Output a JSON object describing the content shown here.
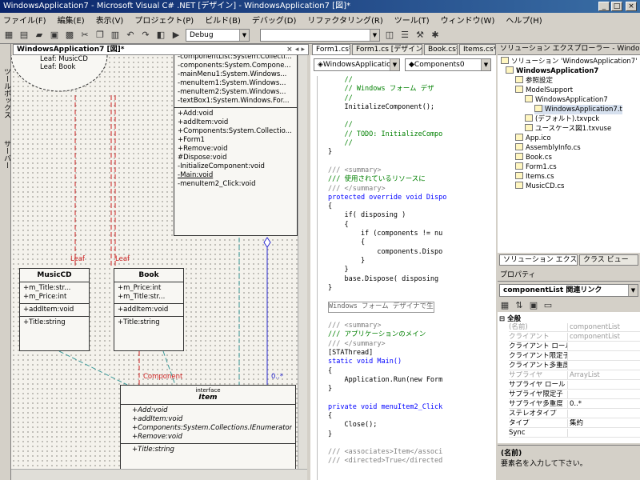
{
  "window": {
    "title": "WindowsApplication7 - Microsoft Visual C# .NET [デザイン] - WindowsApplication7 [図]*"
  },
  "menu": [
    "ファイル(F)",
    "編集(E)",
    "表示(V)",
    "プロジェクト(P)",
    "ビルド(B)",
    "デバッグ(D)",
    "リファクタリング(R)",
    "ツール(T)",
    "ウィンドウ(W)",
    "ヘルプ(H)"
  ],
  "toolbar": {
    "config": "Debug"
  },
  "left_tab": {
    "label1": "ツールボックス",
    "label2": "サーバー"
  },
  "tabs": {
    "designer": "WindowsApplication7 [図]*",
    "editor": [
      "Form1.cs*",
      "Form1.cs [デザイン]*",
      "Book.cs*",
      "Items.cs*"
    ]
  },
  "diagram": {
    "top_partial": [
      "Leaf: MusicCD",
      "Leaf: Book"
    ],
    "form1_fields": [
      "-componentList:System.Collecti...",
      "-components:System.Compone...",
      "-mainMenu1:System.Windows...",
      "-menuItem1:System.Windows...",
      "-menuItem2:System.Windows...",
      "-textBox1:System.Windows.For..."
    ],
    "form1_methods": [
      "+Add:void",
      "+addItem:void",
      "+Components:System.Collectio...",
      "+Form1",
      "+Remove:void",
      "#Dispose:void",
      "-InitializeComponent:void",
      "-Main:void",
      "-menuItem2_Click:void"
    ],
    "musiccd": {
      "name": "MusicCD",
      "fields": [
        "+m_Title:str...",
        "+m_Price:int"
      ],
      "methods": [
        "+addItem:void"
      ],
      "props": [
        "+Title:string"
      ]
    },
    "book": {
      "name": "Book",
      "fields": [
        "+m_Price:int",
        "+m_Title:str..."
      ],
      "methods": [
        "+addItem:void"
      ],
      "props": [
        "+Title:string"
      ]
    },
    "item": {
      "stereotype": "interface",
      "name": "Item",
      "methods": [
        "+Add:void",
        "+addItem:void",
        "+Components:System.Collections.IEnumerator",
        "+Remove:void"
      ],
      "props": [
        "+Title:string"
      ]
    },
    "labels": {
      "leaf1": "Leaf",
      "leaf2": "Leaf",
      "component": "Component",
      "mult": "0..*"
    }
  },
  "editor": {
    "class_combo": "WindowsApplicatior",
    "member_combo": "Components0"
  },
  "code_lines": [
    {
      "t": "    //",
      "c": "cm"
    },
    {
      "t": "    // Windows フォーム デザ",
      "c": "cm"
    },
    {
      "t": "    //",
      "c": "cm"
    },
    {
      "t": "    InitializeComponent();",
      "c": ""
    },
    {
      "t": "",
      "c": ""
    },
    {
      "t": "    //",
      "c": "cm"
    },
    {
      "t": "    // TODO: InitializeCompo",
      "c": "cm"
    },
    {
      "t": "    //",
      "c": "cm"
    },
    {
      "t": "}",
      "c": ""
    },
    {
      "t": "",
      "c": ""
    },
    {
      "t": "/// <summary>",
      "c": "gr"
    },
    {
      "t": "/// 使用されているリソースに",
      "c": "cm"
    },
    {
      "t": "/// </summary>",
      "c": "gr"
    },
    {
      "t": "protected override void Dispo",
      "c": "kw"
    },
    {
      "t": "{",
      "c": ""
    },
    {
      "t": "    if( disposing )",
      "c": ""
    },
    {
      "t": "    {",
      "c": ""
    },
    {
      "t": "        if (components != nu",
      "c": ""
    },
    {
      "t": "        {",
      "c": ""
    },
    {
      "t": "            components.Dispo",
      "c": ""
    },
    {
      "t": "        }",
      "c": ""
    },
    {
      "t": "    }",
      "c": ""
    },
    {
      "t": "    base.Dispose( disposing",
      "c": ""
    },
    {
      "t": "}",
      "c": ""
    },
    {
      "t": "",
      "c": ""
    },
    {
      "t": "Windows フォーム デザイナで生",
      "c": "rg"
    },
    {
      "t": "",
      "c": ""
    },
    {
      "t": "/// <summary>",
      "c": "gr"
    },
    {
      "t": "/// アプリケーションのメイン",
      "c": "cm"
    },
    {
      "t": "/// </summary>",
      "c": "gr"
    },
    {
      "t": "[STAThread]",
      "c": ""
    },
    {
      "t": "static void Main()",
      "c": "kw"
    },
    {
      "t": "{",
      "c": ""
    },
    {
      "t": "    Application.Run(new Form",
      "c": ""
    },
    {
      "t": "}",
      "c": ""
    },
    {
      "t": "",
      "c": ""
    },
    {
      "t": "private void menuItem2_Click",
      "c": "kw"
    },
    {
      "t": "{",
      "c": ""
    },
    {
      "t": "    Close();",
      "c": ""
    },
    {
      "t": "}",
      "c": ""
    },
    {
      "t": "",
      "c": ""
    },
    {
      "t": "/// <associates>Item</associ",
      "c": "gr"
    },
    {
      "t": "/// <directed>True</directed",
      "c": "gr"
    }
  ],
  "solution_explorer": {
    "title": "ソリューション エクスプローラー - Windows",
    "tree": [
      "ソリューション 'WindowsApplication7' (1",
      "WindowsApplication7",
      "参照設定",
      "ModelSupport",
      "WindowsApplication7",
      "WindowsApplication7.t",
      "(デフォルト).txvpck",
      "ユースケース図1.txvuse",
      "App.ico",
      "AssemblyInfo.cs",
      "Book.cs",
      "Form1.cs",
      "Items.cs",
      "MusicCD.cs"
    ],
    "tab1": "ソリューション エクス...",
    "tab2": "クラス ビュー"
  },
  "properties": {
    "title": "プロパティ",
    "object": "componentList 関連リンク",
    "category": "全般",
    "rows": [
      {
        "n": "(名前)",
        "v": "componentList"
      },
      {
        "n": "クライアント",
        "v": "componentList"
      },
      {
        "n": "クライアント ロール",
        "v": ""
      },
      {
        "n": "クライアント限定子",
        "v": ""
      },
      {
        "n": "クライアント多重度",
        "v": ""
      },
      {
        "n": "サプライヤ",
        "v": "ArrayList"
      },
      {
        "n": "サプライヤ ロール",
        "v": ""
      },
      {
        "n": "サプライヤ限定子",
        "v": ""
      },
      {
        "n": "サプライヤ多重度",
        "v": "0..*"
      },
      {
        "n": "ステレオタイプ",
        "v": ""
      },
      {
        "n": "タイプ",
        "v": "集約"
      },
      {
        "n": "Sync",
        "v": ""
      }
    ],
    "desc_title": "(名前)",
    "desc_text": "要素名を入力して下さい。"
  }
}
